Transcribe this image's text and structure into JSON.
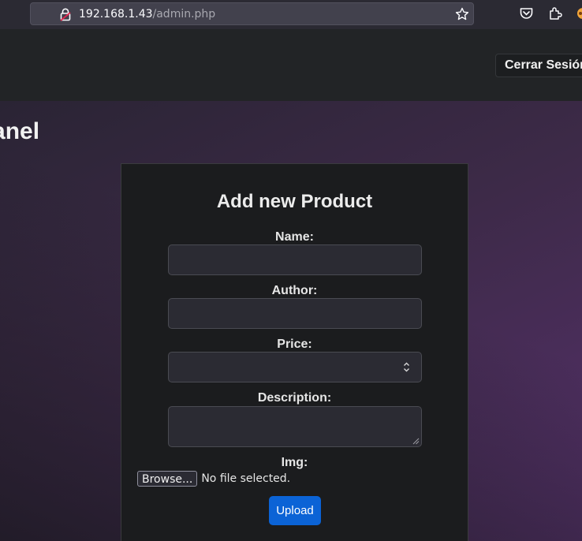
{
  "browser": {
    "url_host": "192.168.1.43",
    "url_path": "/admin.php"
  },
  "header": {
    "logout_label": "Cerrar Sesión"
  },
  "main": {
    "panel_title": "Panel"
  },
  "form": {
    "title": "Add new Product",
    "name_label": "Name:",
    "name_value": "",
    "author_label": "Author:",
    "author_value": "",
    "price_label": "Price:",
    "price_value": "",
    "description_label": "Description:",
    "description_value": "",
    "img_label": "Img:",
    "browse_label": "Browse...",
    "file_status": "No file selected.",
    "upload_label": "Upload"
  },
  "colors": {
    "accent": "#0b63d6",
    "card_bg": "#1b1c1e",
    "header_bg": "#222426"
  },
  "icons": [
    "shield-icon",
    "lock-icon",
    "bookmark-star-icon",
    "pocket-icon",
    "extensions-icon",
    "spinner-arrows-icon",
    "resize-handle-icon"
  ]
}
